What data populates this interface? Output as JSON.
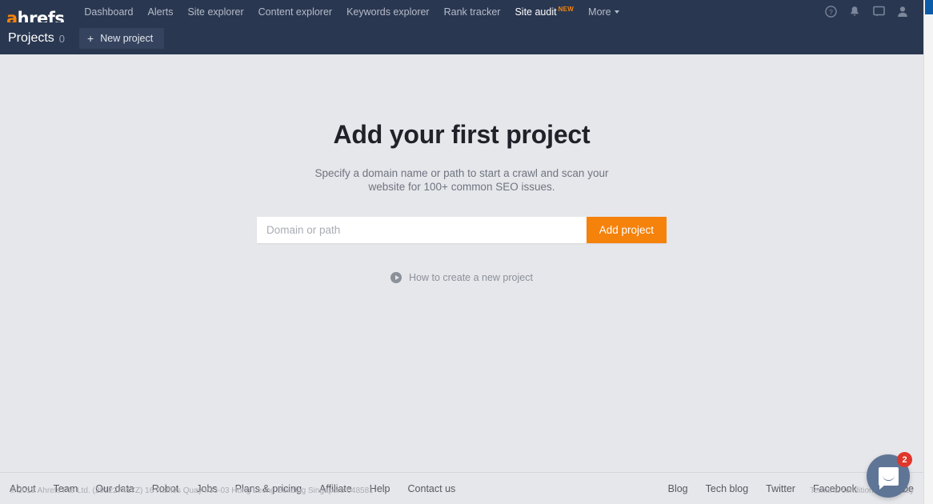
{
  "topnav": {
    "logo": {
      "accent_letter": "a",
      "rest": "hrefs",
      "accent_color": "#f5820b"
    },
    "links": [
      {
        "label": "Dashboard",
        "active": false
      },
      {
        "label": "Alerts",
        "active": false
      },
      {
        "label": "Site explorer",
        "active": false
      },
      {
        "label": "Content explorer",
        "active": false
      },
      {
        "label": "Keywords explorer",
        "active": false
      },
      {
        "label": "Rank tracker",
        "active": false
      },
      {
        "label": "Site audit",
        "active": true,
        "badge": "NEW"
      },
      {
        "label": "More",
        "active": false,
        "caret": true
      }
    ],
    "icons": [
      {
        "name": "help-icon"
      },
      {
        "name": "notifications-bell-icon"
      },
      {
        "name": "messages-icon"
      },
      {
        "name": "user-account-icon"
      }
    ]
  },
  "subnav": {
    "title": "Projects",
    "count": "0",
    "new_project_label": "New project",
    "plus_glyph": "+"
  },
  "main": {
    "title": "Add your first project",
    "description": "Specify a domain name or path to start a crawl and scan your website for 100+ common SEO issues.",
    "input_placeholder": "Domain or path",
    "input_value": "",
    "add_button_label": "Add project",
    "howto_label": "How to create a new project"
  },
  "footer": {
    "left_links": [
      "About",
      "Team",
      "Our data",
      "Robot",
      "Jobs",
      "Plans & pricing",
      "Affiliate",
      "Help",
      "Contact us"
    ],
    "right_links": [
      "Blog",
      "Tech blog",
      "Twitter",
      "Facebook",
      "YouTube"
    ],
    "copyright": "© 2019 Ahrefs Pte Ltd. (201227417Z) 16 Raffles Quay #33-03 Hong Leong Building Singapore 048581",
    "terms_label": "Terms & conditions",
    "legal_separator": "|",
    "privacy_label": "Privacy"
  },
  "chat_widget": {
    "name": "intercom-launcher",
    "unread_count": "2"
  },
  "colors": {
    "nav_background": "#2a3750",
    "subnav_button": "#35435e",
    "page_background": "#e6e7eb",
    "accent_orange": "#f5820b",
    "badge_red": "#e0362c",
    "chat_blue": "#5f7596"
  }
}
